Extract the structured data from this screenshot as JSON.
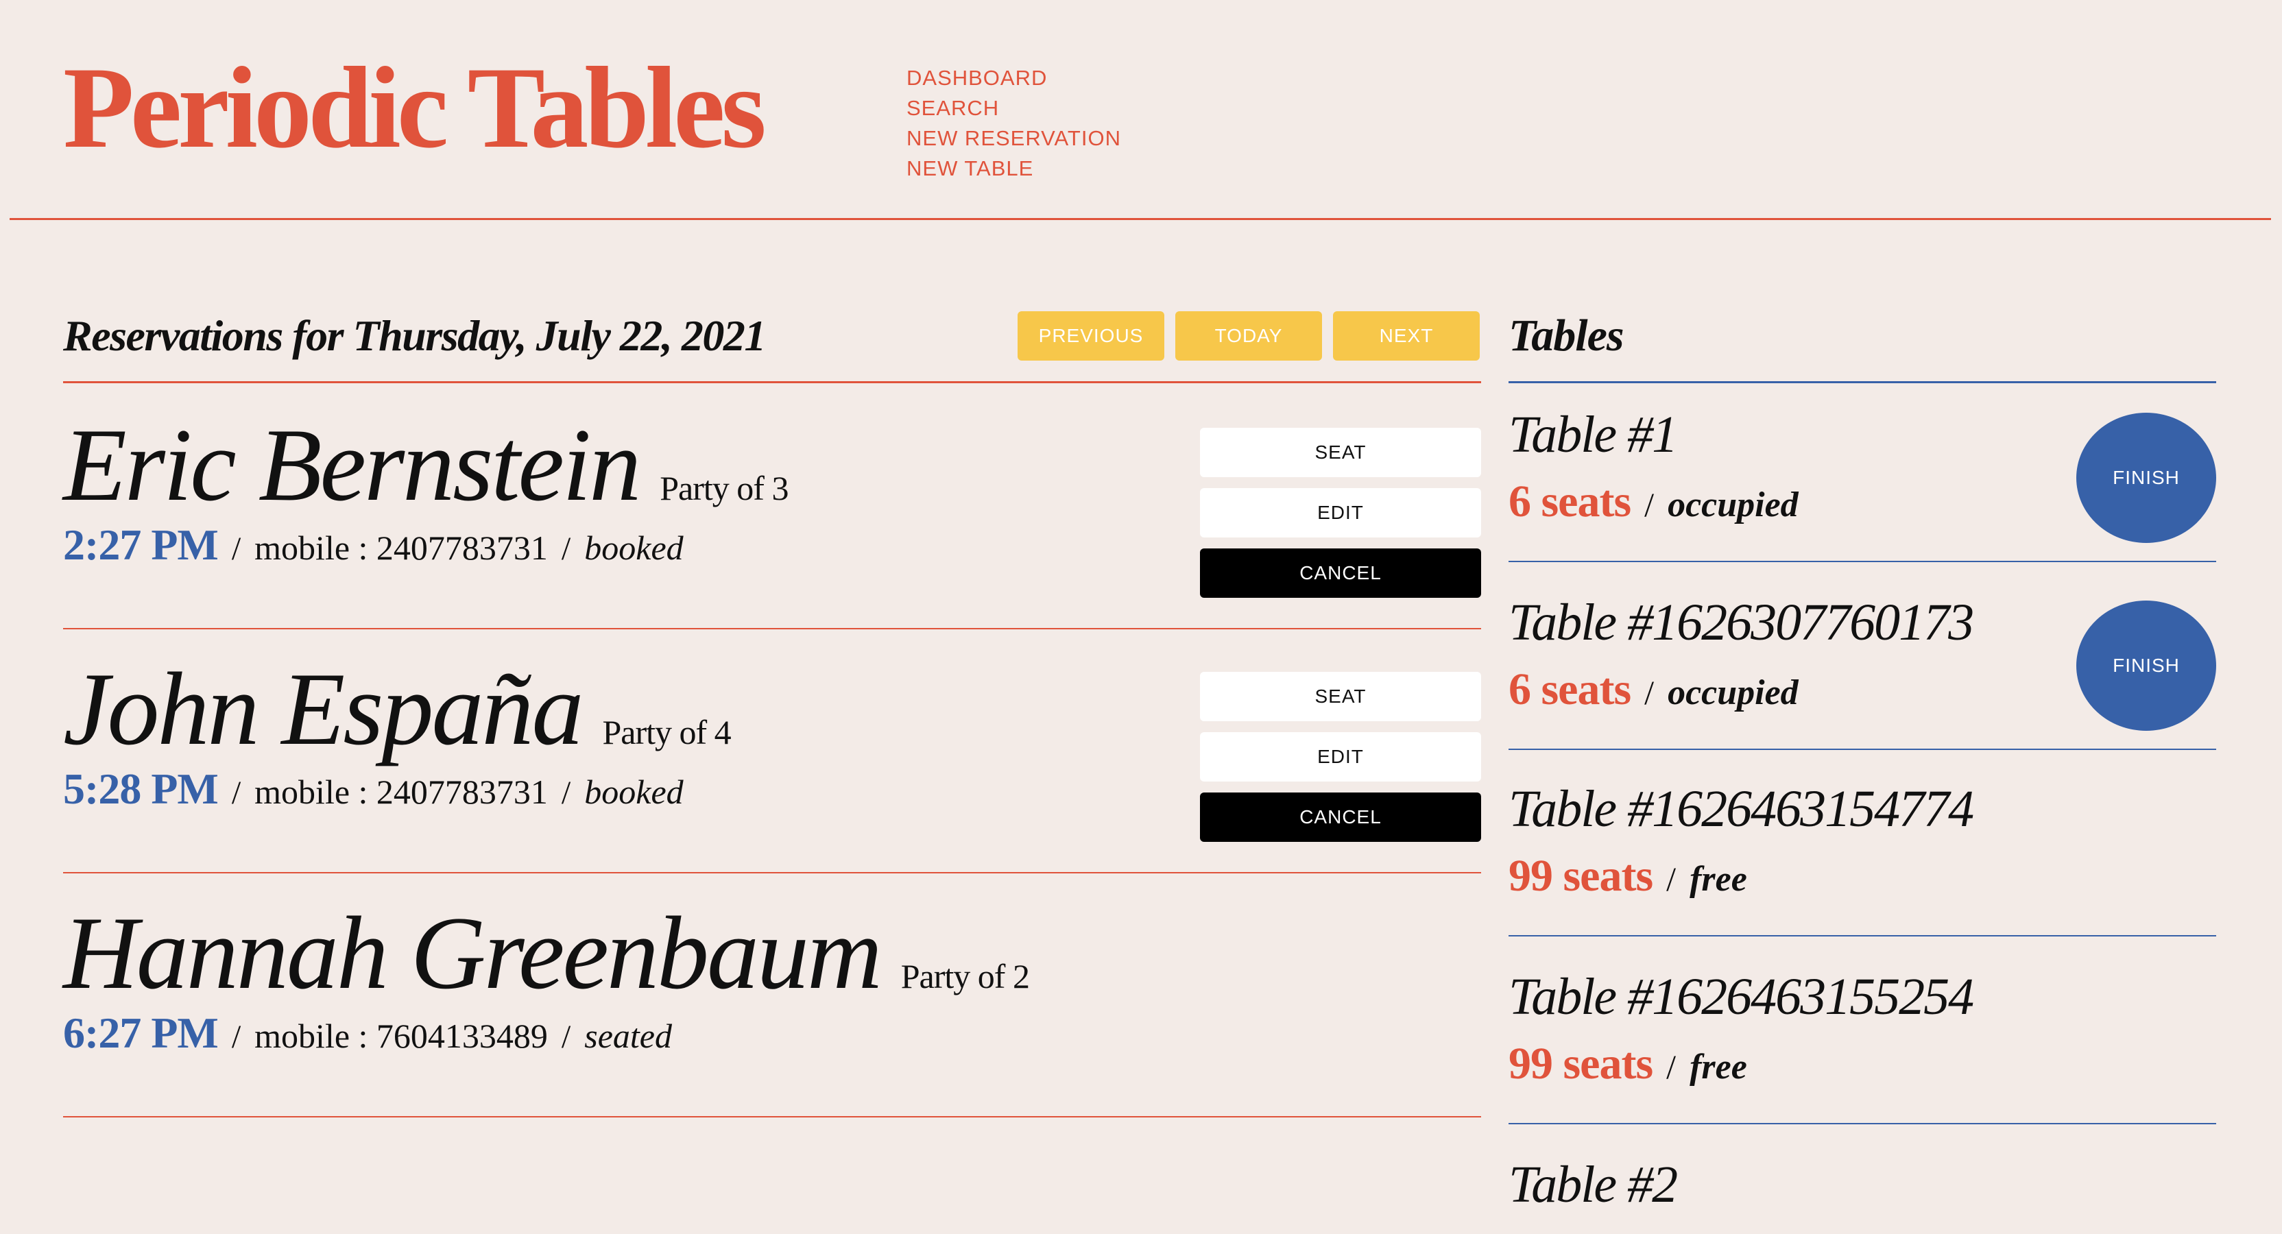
{
  "brand": {
    "title": "Periodic Tables"
  },
  "nav": {
    "items": [
      {
        "label": "DASHBOARD"
      },
      {
        "label": "SEARCH"
      },
      {
        "label": "NEW RESERVATION"
      },
      {
        "label": "NEW TABLE"
      }
    ]
  },
  "reservations": {
    "heading": "Reservations for Thursday, July 22, 2021",
    "date_nav": {
      "previous": "PREVIOUS",
      "today": "TODAY",
      "next": "NEXT"
    },
    "list": [
      {
        "name": "Eric Bernstein",
        "party": "Party of 3",
        "time": "2:27 PM",
        "mobile": "mobile : 2407783731",
        "status": "booked",
        "actions": {
          "seat": "SEAT",
          "edit": "EDIT",
          "cancel": "CANCEL"
        }
      },
      {
        "name": "John España",
        "party": "Party of 4",
        "time": "5:28 PM",
        "mobile": "mobile : 2407783731",
        "status": "booked",
        "actions": {
          "seat": "SEAT",
          "edit": "EDIT",
          "cancel": "CANCEL"
        }
      },
      {
        "name": "Hannah Greenbaum",
        "party": "Party of 2",
        "time": "6:27 PM",
        "mobile": "mobile : 7604133489",
        "status": "seated"
      }
    ]
  },
  "tables": {
    "heading": "Tables",
    "list": [
      {
        "name": "Table #1",
        "seats": "6 seats",
        "status": "occupied",
        "finish": "FINISH"
      },
      {
        "name": "Table #1626307760173",
        "seats": "6 seats",
        "status": "occupied",
        "finish": "FINISH"
      },
      {
        "name": "Table #1626463154774",
        "seats": "99 seats",
        "status": "free"
      },
      {
        "name": "Table #1626463155254",
        "seats": "99 seats",
        "status": "free"
      },
      {
        "name": "Table #2"
      }
    ]
  },
  "separators": {
    "slash": "/"
  },
  "colors": {
    "background": "#f3ebe7",
    "accent_red": "#e0533b",
    "accent_blue": "#3761a8",
    "button_yellow": "#f7c74a"
  }
}
